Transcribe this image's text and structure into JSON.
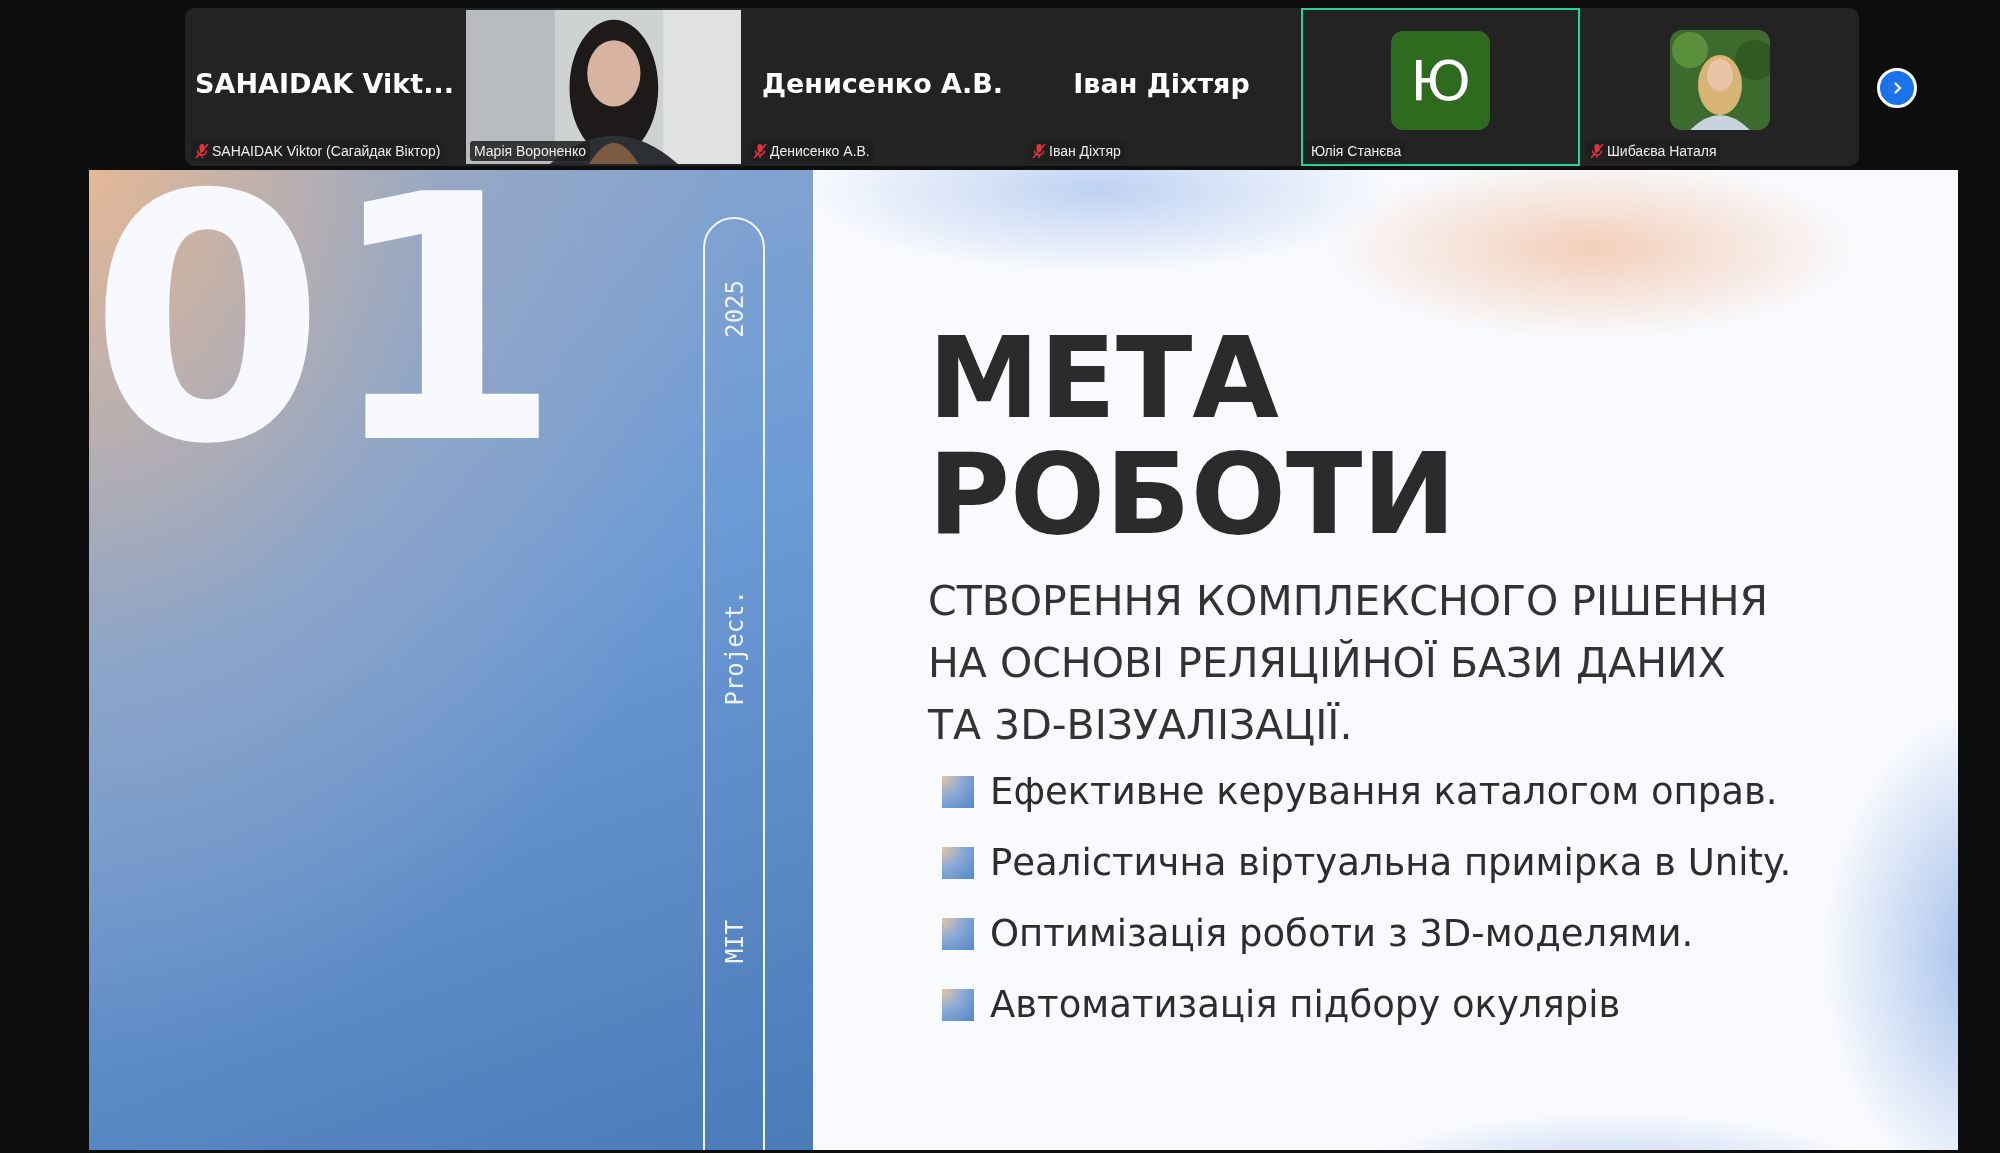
{
  "participants": [
    {
      "kind": "name",
      "display_name": "SAHAIDAK  Vikt...",
      "label": "SAHAIDAK Viktor (Сагайдак Віктор)",
      "muted": true,
      "speaking": false
    },
    {
      "kind": "video",
      "label": "Марія Вороненко",
      "muted": false,
      "speaking": false
    },
    {
      "kind": "name",
      "display_name": "Денисенко А.В.",
      "label": "Денисенко А.В.",
      "muted": true,
      "speaking": false
    },
    {
      "kind": "name",
      "display_name": "Іван Діхтяр",
      "label": "Іван Діхтяр",
      "muted": true,
      "speaking": false
    },
    {
      "kind": "avatar",
      "initial": "Ю",
      "color": "#2f6b1f",
      "label": "Юлія Станєва",
      "muted": false,
      "speaking": true
    },
    {
      "label": "Шибаєва Наталя",
      "muted": true,
      "speaking": false
    }
  ],
  "slide": {
    "number": "01",
    "side_labels": [
      "2025",
      "Project.",
      "MIT"
    ],
    "title_lines": [
      "МЕТА",
      "РОБОТИ"
    ],
    "subtitle_lines": [
      "СТВОРЕННЯ КОМПЛЕКСНОГО РІШЕННЯ",
      "НА ОСНОВІ РЕЛЯЦІЙНОЇ БАЗИ ДАНИХ",
      "ТА 3D-ВІЗУАЛІЗАЦІЇ."
    ],
    "bullets": [
      "Ефективне керування каталогом оправ.",
      "Реалістична віртуальна примірка в Unity.",
      "Оптимізація роботи з 3D-моделями.",
      "Автоматизація підбору окулярів"
    ]
  }
}
